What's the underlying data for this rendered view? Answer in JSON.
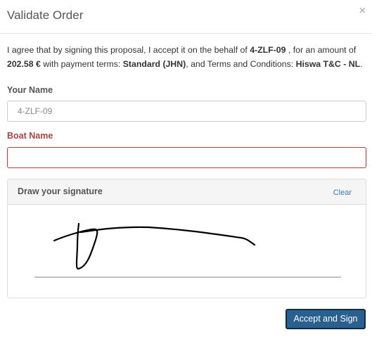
{
  "header": {
    "title": "Validate Order",
    "close_symbol": "×"
  },
  "agreement": {
    "text_1": "I agree that by signing this proposal, I accept it on the behalf of ",
    "partner": "4-ZLF-09",
    "text_2": " , for an amount of ",
    "amount": "202.58 €",
    "text_3": " with payment terms: ",
    "payment_terms": "Standard (JHN)",
    "text_4": ", and Terms and Conditions: ",
    "terms": "Hiswa T&C - NL",
    "text_5": "."
  },
  "form": {
    "name_label": "Your Name",
    "name_placeholder": "4-ZLF-09",
    "name_value": "",
    "boat_label": "Boat Name",
    "boat_value": ""
  },
  "signature": {
    "title": "Draw your signature",
    "clear_label": "Clear"
  },
  "footer": {
    "accept_label": "Accept and Sign"
  },
  "colors": {
    "primary_button": "#286090",
    "error_red": "#a94442",
    "link_blue": "#337ab7"
  }
}
